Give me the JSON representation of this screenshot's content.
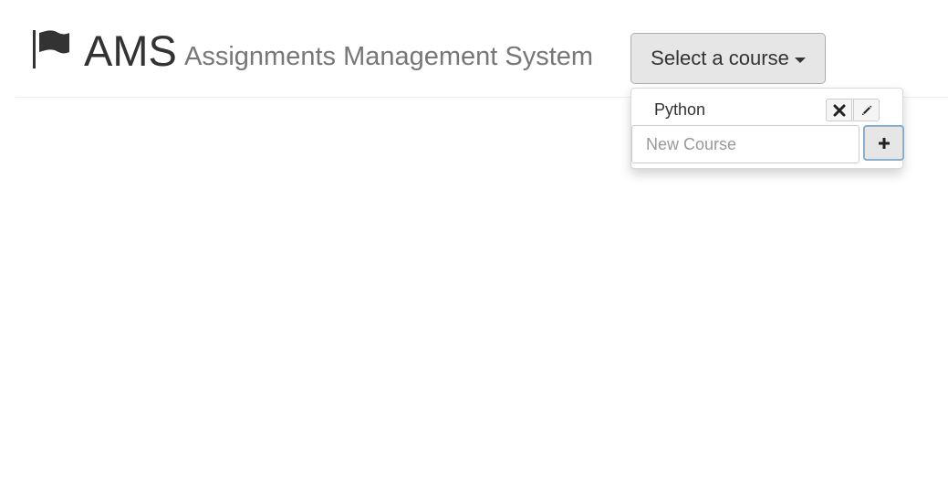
{
  "header": {
    "icon": "flag-icon",
    "title": "AMS",
    "subtitle": "Assignments Management System"
  },
  "course_selector": {
    "label": "Select a course",
    "icon": "caret-down-icon"
  },
  "dropdown": {
    "courses": [
      {
        "name": "Python",
        "delete_icon": "close-icon",
        "edit_icon": "pencil-icon"
      }
    ],
    "new_course": {
      "placeholder": "New Course",
      "value": "",
      "add_icon": "plus-icon"
    }
  }
}
